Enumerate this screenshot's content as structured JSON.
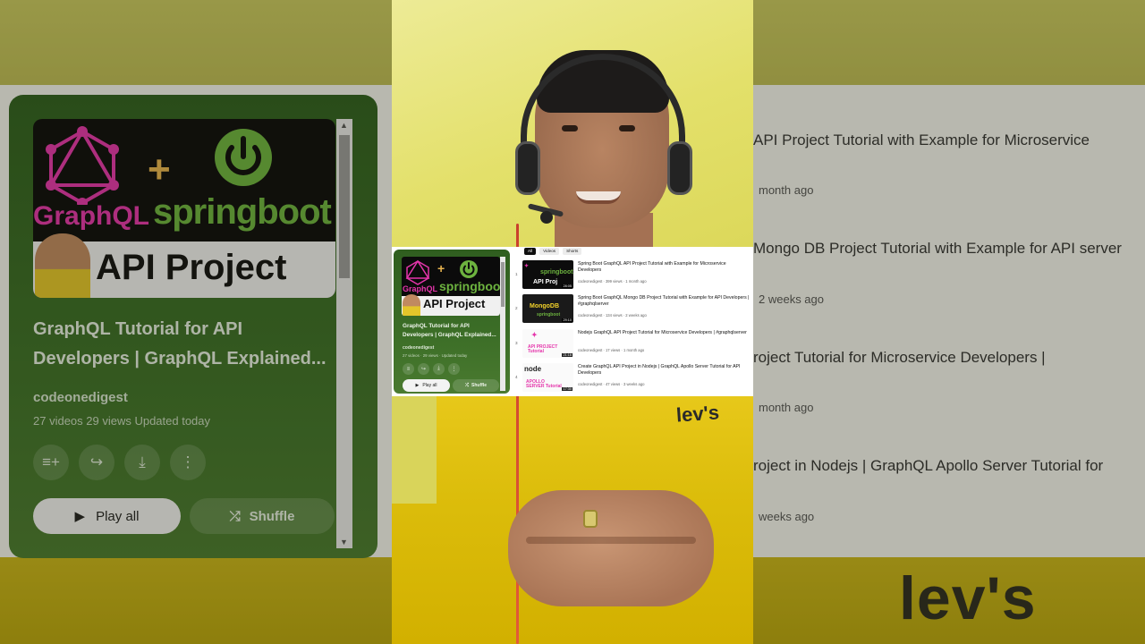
{
  "playlist": {
    "title": "GraphQL Tutorial for API Developers | GraphQL Explained...",
    "owner": "codeonedigest",
    "meta": "27 videos   29 views   Updated today",
    "meta_small": "27 videos · 29 views · Updated today",
    "play_all_label": "Play all",
    "shuffle_label": "Shuffle",
    "thumbnail": {
      "graphql_text": "GraphQL",
      "plus_text": "+",
      "spring_text": "springboot",
      "api_text": "API Project"
    }
  },
  "filters": [
    "All",
    "Videos",
    "Shorts"
  ],
  "videos": [
    {
      "index": "1",
      "title": "Spring Boot GraphQL API Project Tutorial with Example for Microservice Developers",
      "meta": "codeonedigest · 399 views · 1 month ago",
      "duration": "28:05",
      "thumb_text": "API Proj"
    },
    {
      "index": "2",
      "title": "Spring Boot GraphQL Mongo DB Project Tutorial with Example for API Developers | #graphqlserver",
      "meta": "codeonedigest · 134 views · 2 weeks ago",
      "duration": "29:10",
      "thumb_text": "MongoDB"
    },
    {
      "index": "3",
      "title": "Nodejs GraphQL API Project Tutorial for Microservice Developers | #graphqlserver",
      "meta": "codeonedigest · 17 views · 1 month ago",
      "duration": "21:16",
      "thumb_text": "API PROJECT Tutorial"
    },
    {
      "index": "4",
      "title": "Create GraphQL API Project in Nodejs | GraphQL Apollo Server Tutorial for API Developers",
      "meta": "codeonedigest · 47 views · 3 weeks ago",
      "duration": "17:30",
      "thumb_text": "APOLLO SERVER Tutorial"
    }
  ],
  "background_list": [
    {
      "title": "API Project Tutorial with Example for Microservice",
      "meta": "month ago"
    },
    {
      "title": "Mongo DB Project Tutorial with Example for API server",
      "meta": "2 weeks ago"
    },
    {
      "title": "roject Tutorial for Microservice Developers |",
      "meta": "month ago"
    },
    {
      "title": "roject in Nodejs | GraphQL Apollo Server Tutorial for",
      "meta": "weeks ago"
    }
  ],
  "shirt_logo": "lev's",
  "colors": {
    "playlist_card": "#3d7028",
    "graphql_pink": "#e535ab",
    "spring_green": "#6db33f",
    "shirt_yellow": "#dcbd0b",
    "wall_yellow": "#e3e06a"
  },
  "icons": [
    "add-to-queue-icon",
    "share-icon",
    "download-icon",
    "more-icon",
    "play-icon",
    "shuffle-icon"
  ]
}
